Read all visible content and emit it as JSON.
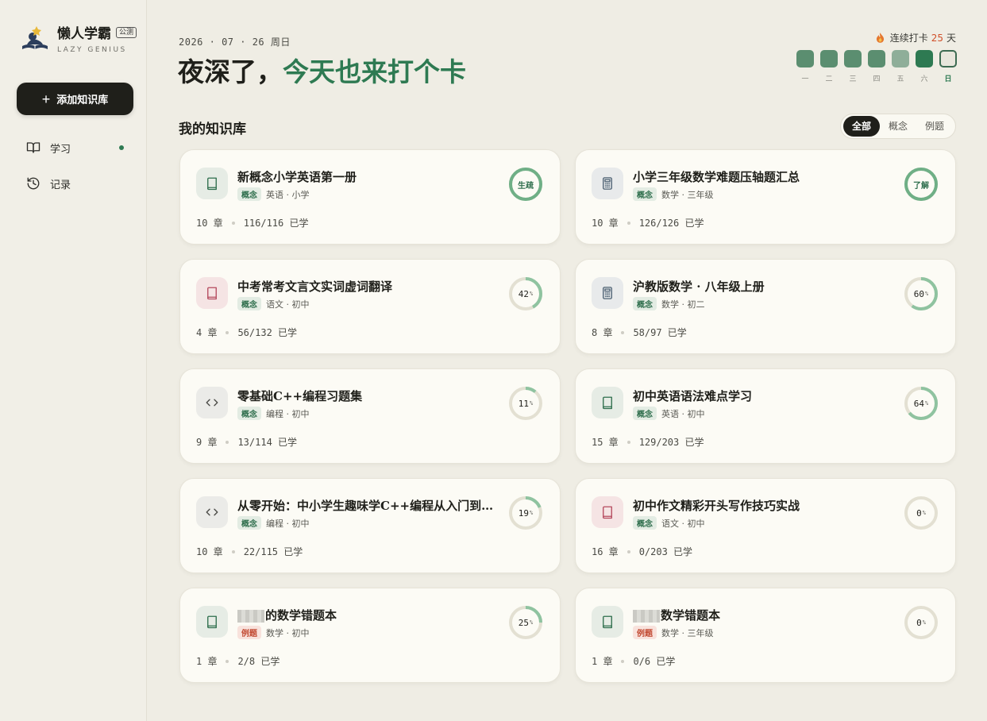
{
  "brand": {
    "name": "懒人学霸",
    "badge": "公测",
    "subtitle": "LAZY GENIUS"
  },
  "sidebar": {
    "add_label": "添加知识库",
    "items": [
      {
        "label": "学习",
        "icon": "book-open-icon"
      },
      {
        "label": "记录",
        "icon": "history-icon"
      }
    ]
  },
  "header": {
    "date": "2026 · 07 · 26  周日",
    "greeting_main": "夜深了，",
    "greeting_accent": "今天也来打个卡"
  },
  "streak": {
    "prefix": "连续打卡",
    "count": "25",
    "suffix": "天"
  },
  "week": {
    "days": [
      "一",
      "二",
      "三",
      "四",
      "五",
      "六",
      "日"
    ],
    "status": [
      "done",
      "done",
      "done",
      "done",
      "light",
      "dark",
      "today"
    ]
  },
  "section": {
    "title": "我的知识库"
  },
  "filters": [
    "全部",
    "概念",
    "例题"
  ],
  "colors": {
    "accent": "#2e7a52",
    "ring_fill": "#8fc3a0",
    "ring_track": "#e3e0d2",
    "streak_num": "#d0502a"
  },
  "cards": [
    {
      "title": "新概念小学英语第一册",
      "icon": "book-icon",
      "icon_color": "green",
      "tag": "概念",
      "tag_type": "concept",
      "subject": "英语 · 小学",
      "chapters": "10 章",
      "studied": "116/116 已学",
      "progress": 100,
      "status": "生疏"
    },
    {
      "title": "小学三年级数学难题压轴题汇总",
      "icon": "calculator-icon",
      "icon_color": "blue",
      "tag": "概念",
      "tag_type": "concept",
      "subject": "数学 · 三年级",
      "chapters": "10 章",
      "studied": "126/126 已学",
      "progress": 100,
      "status": "了解"
    },
    {
      "title": "中考常考文言文实词虚词翻译",
      "icon": "book-icon",
      "icon_color": "pink",
      "tag": "概念",
      "tag_type": "concept",
      "subject": "语文 · 初中",
      "chapters": "4 章",
      "studied": "56/132 已学",
      "progress": 42,
      "status": ""
    },
    {
      "title": "沪教版数学 · 八年级上册",
      "icon": "calculator-icon",
      "icon_color": "blue",
      "tag": "概念",
      "tag_type": "concept",
      "subject": "数学 · 初二",
      "chapters": "8 章",
      "studied": "58/97 已学",
      "progress": 60,
      "status": ""
    },
    {
      "title": "零基础C++编程习题集",
      "icon": "code-icon",
      "icon_color": "gray",
      "tag": "概念",
      "tag_type": "concept",
      "subject": "编程 · 初中",
      "chapters": "9 章",
      "studied": "13/114 已学",
      "progress": 11,
      "status": ""
    },
    {
      "title": "初中英语语法难点学习",
      "icon": "book-icon",
      "icon_color": "green",
      "tag": "概念",
      "tag_type": "concept",
      "subject": "英语 · 初中",
      "chapters": "15 章",
      "studied": "129/203 已学",
      "progress": 64,
      "status": ""
    },
    {
      "title": "从零开始：中小学生趣味学C++编程从入门到精通",
      "icon": "code-icon",
      "icon_color": "gray",
      "tag": "概念",
      "tag_type": "concept",
      "subject": "编程 · 初中",
      "chapters": "10 章",
      "studied": "22/115 已学",
      "progress": 19,
      "status": ""
    },
    {
      "title": "初中作文精彩开头写作技巧实战",
      "icon": "book-icon",
      "icon_color": "pink",
      "tag": "概念",
      "tag_type": "concept",
      "subject": "语文 · 初中",
      "chapters": "16 章",
      "studied": "0/203 已学",
      "progress": 0,
      "status": ""
    },
    {
      "title": "的数学错题本",
      "redacted": true,
      "icon": "book-icon",
      "icon_color": "green",
      "tag": "例题",
      "tag_type": "example",
      "subject": "数学 · 初中",
      "chapters": "1 章",
      "studied": "2/8 已学",
      "progress": 25,
      "status": ""
    },
    {
      "title": "数学错题本",
      "redacted": true,
      "icon": "book-icon",
      "icon_color": "green",
      "tag": "例题",
      "tag_type": "example",
      "subject": "数学 · 三年级",
      "chapters": "1 章",
      "studied": "0/6 已学",
      "progress": 0,
      "status": ""
    }
  ]
}
